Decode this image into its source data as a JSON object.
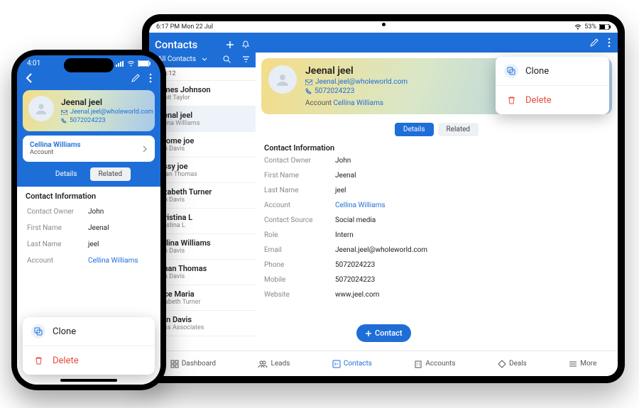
{
  "status": {
    "tablet_time": "6:17 PM  Mon 22 Jul",
    "tablet_batt": "53%",
    "phone_time": "4:01"
  },
  "module": "Contacts",
  "filter": "All Contacts",
  "count_label": "acts:",
  "count": "12",
  "contacts": [
    {
      "name": "James Johnson",
      "sub": "Sumit Taylor"
    },
    {
      "name": "Jeenal jeel",
      "sub": "Cellina Williams"
    },
    {
      "name": "Jerome joe",
      "sub": "Alan Davis"
    },
    {
      "name": "Jessy joe",
      "sub": "Johan Thomas"
    },
    {
      "name": "Elizabeth Turner",
      "sub": "Alan Davis"
    },
    {
      "name": "Christina L",
      "sub": "Christina L"
    },
    {
      "name": "Cellina Williams",
      "sub": "Alan Davis"
    },
    {
      "name": "Johan Thomas",
      "sub": "Alan Davis"
    },
    {
      "name": "Alice Maria",
      "sub": "Elizabeth Turner"
    },
    {
      "name": "Alan Davis",
      "sub": "Press Associates"
    }
  ],
  "add_label": "Contact",
  "profile": {
    "name": "Jeenal jeel",
    "email": "Jeenal.jeel@wholeworld.com",
    "phone": "5072024223",
    "account_label": "Account",
    "account": "Cellina Williams"
  },
  "tabs": {
    "details": "Details",
    "related": "Related"
  },
  "section": "Contact Information",
  "fields": [
    {
      "label": "Contact Owner",
      "value": "John"
    },
    {
      "label": "First Name",
      "value": "Jeenal"
    },
    {
      "label": "Last Name",
      "value": "jeel"
    },
    {
      "label": "Account",
      "value": "Cellina Williams",
      "link": true
    },
    {
      "label": "Contact Source",
      "value": "Social media"
    },
    {
      "label": "Role",
      "value": "Intern"
    },
    {
      "label": "Email",
      "value": "Jeenal.jeel@wholeworld.com"
    },
    {
      "label": "Phone",
      "value": "5072024223"
    },
    {
      "label": "Mobile",
      "value": "5072024223"
    },
    {
      "label": "Website",
      "value": "www.jeel.com"
    }
  ],
  "phone_fields": [
    {
      "label": "Contact Owner",
      "value": "John"
    },
    {
      "label": "First Name",
      "value": "Jeenal"
    },
    {
      "label": "Last Name",
      "value": "jeel"
    },
    {
      "label": "Account",
      "value": "Cellina Williams",
      "link": true
    }
  ],
  "menu": {
    "clone": "Clone",
    "del": "Delete"
  },
  "tabbar": {
    "dashboard": "Dashboard",
    "leads": "Leads",
    "contacts": "Contacts",
    "accounts": "Accounts",
    "deals": "Deals",
    "more": "More"
  }
}
